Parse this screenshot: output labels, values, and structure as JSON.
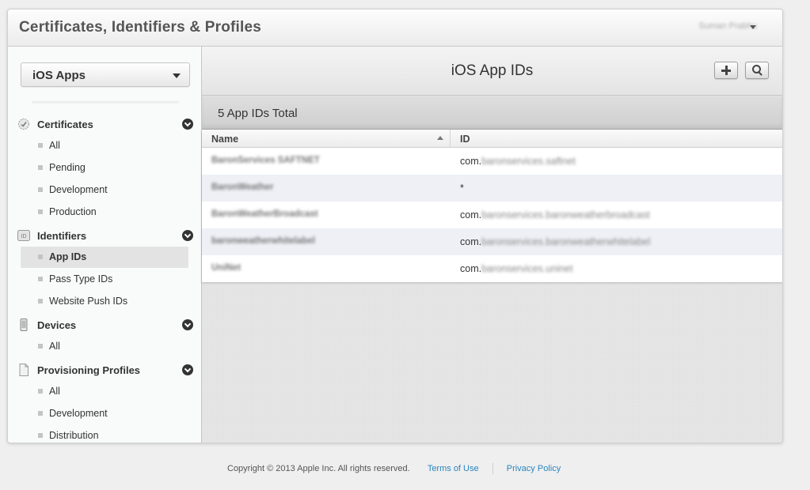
{
  "header": {
    "app_title": "Certificates, Identifiers & Profiles",
    "user_name": "Suman Prabhu"
  },
  "sidebar": {
    "platform_select": {
      "value": "iOS Apps"
    },
    "sections": [
      {
        "label": "Certificates",
        "icon": "certificate-icon",
        "items": [
          "All",
          "Pending",
          "Development",
          "Production"
        ]
      },
      {
        "label": "Identifiers",
        "icon": "id-icon",
        "items": [
          "App IDs",
          "Pass Type IDs",
          "Website Push IDs"
        ]
      },
      {
        "label": "Devices",
        "icon": "iphone-icon",
        "items": [
          "All"
        ]
      },
      {
        "label": "Provisioning Profiles",
        "icon": "document-icon",
        "items": [
          "All",
          "Development",
          "Distribution"
        ]
      }
    ],
    "active_item": "App IDs"
  },
  "main": {
    "title": "iOS App IDs",
    "count_label": "5 App IDs Total",
    "columns": [
      "Name",
      "ID"
    ],
    "rows": [
      {
        "name": "BaronServices SAFTNET",
        "id_prefix": "com.",
        "id_suffix": "baronservices.saftnet"
      },
      {
        "name": "BaronWeather",
        "id_prefix": "*",
        "id_suffix": ""
      },
      {
        "name": "BaronWeatherBroadcast",
        "id_prefix": "com.",
        "id_suffix": "baronservices.baronweatherbroadcast"
      },
      {
        "name": "baronweatherwhitelabel",
        "id_prefix": "com.",
        "id_suffix": "baronservices.baronweatherwhitelabel"
      },
      {
        "name": "UniNet",
        "id_prefix": "com.",
        "id_suffix": "baronservices.uninet"
      }
    ]
  },
  "footer": {
    "copyright": "Copyright © 2013 Apple Inc. All rights reserved.",
    "terms": "Terms of Use",
    "privacy": "Privacy Policy"
  }
}
